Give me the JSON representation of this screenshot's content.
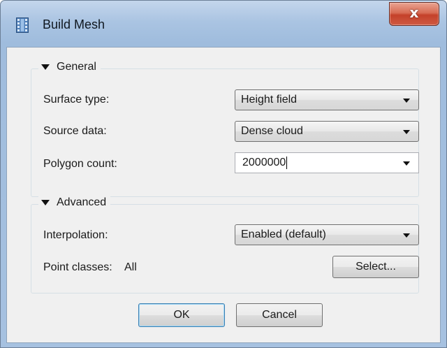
{
  "window": {
    "title": "Build Mesh",
    "icon": "film-strip-icon",
    "close_label": "x"
  },
  "general": {
    "section_label": "General",
    "surface_type": {
      "label": "Surface type:",
      "value": "Height field"
    },
    "source_data": {
      "label": "Source data:",
      "value": "Dense cloud"
    },
    "polygon_count": {
      "label": "Polygon count:",
      "value": "2000000"
    }
  },
  "advanced": {
    "section_label": "Advanced",
    "interpolation": {
      "label": "Interpolation:",
      "value": "Enabled (default)"
    },
    "point_classes": {
      "label": "Point classes:",
      "value": "All",
      "select_label": "Select..."
    }
  },
  "buttons": {
    "ok": "OK",
    "cancel": "Cancel"
  },
  "colors": {
    "close_button": "#c4412a",
    "title_bar": "#aac4e2",
    "dialog_bg": "#f0f0f0",
    "default_button_border": "#3c7fb1"
  }
}
